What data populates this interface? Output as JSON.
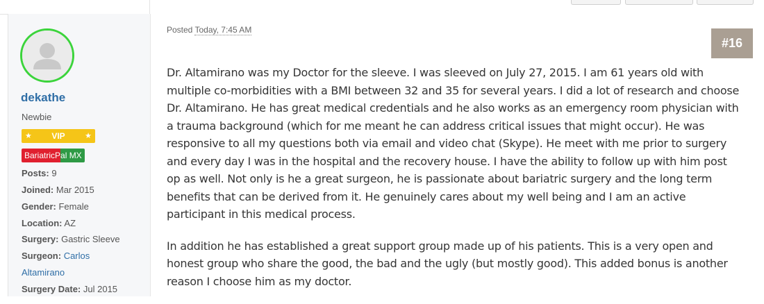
{
  "author": {
    "username": "dekathe",
    "rank": "Newbie",
    "vip_badge": "VIP",
    "group_badge_part1": "BariatricP",
    "group_badge_part2": "al MX",
    "avatar_ring_color": "#3bd43b",
    "fields": [
      {
        "label": "Posts:",
        "value": "9"
      },
      {
        "label": "Joined:",
        "value": "Mar 2015"
      },
      {
        "label": "Gender:",
        "value": "Female"
      },
      {
        "label": "Location:",
        "value": "AZ"
      },
      {
        "label": "Surgery:",
        "value": "Gastric Sleeve"
      },
      {
        "label": "Surgeon:",
        "value": "Carlos",
        "value2": "Altamirano"
      },
      {
        "label": "Surgery Date:",
        "value": "Jul 2015"
      }
    ]
  },
  "post": {
    "posted_label": "Posted",
    "posted_time": "Today, 7:45 AM",
    "number": "#16",
    "paragraphs": [
      "Dr. Altamirano was my Doctor for the sleeve.  I was sleeved on July 27, 2015. I am 61 years old with multiple co-morbidities with a BMI between 32 and 35 for several years.   I did a lot of research and choose Dr. Altamirano.  He has great medical credentials and he also works as an emergency room physician with a trauma background (which for me meant he can address critical issues that might occur).  He was responsive to all my questions both via email and video chat (Skype).  He meet with me prior to surgery and every day I was in the hospital and the recovery house.  I have the ability to follow up with him post op as well.   Not only is he a great surgeon, he is passionate about bariatric surgery and the long term benefits that can be derived from it.  He genuinely cares about my well being and I am an active participant in this medical process.",
      "In addition he has established a great support group made up of his patients. This is a very open and honest group who share the good, the bad and the ugly (but mostly good).  This added bonus is another reason I choose him as my doctor."
    ]
  }
}
